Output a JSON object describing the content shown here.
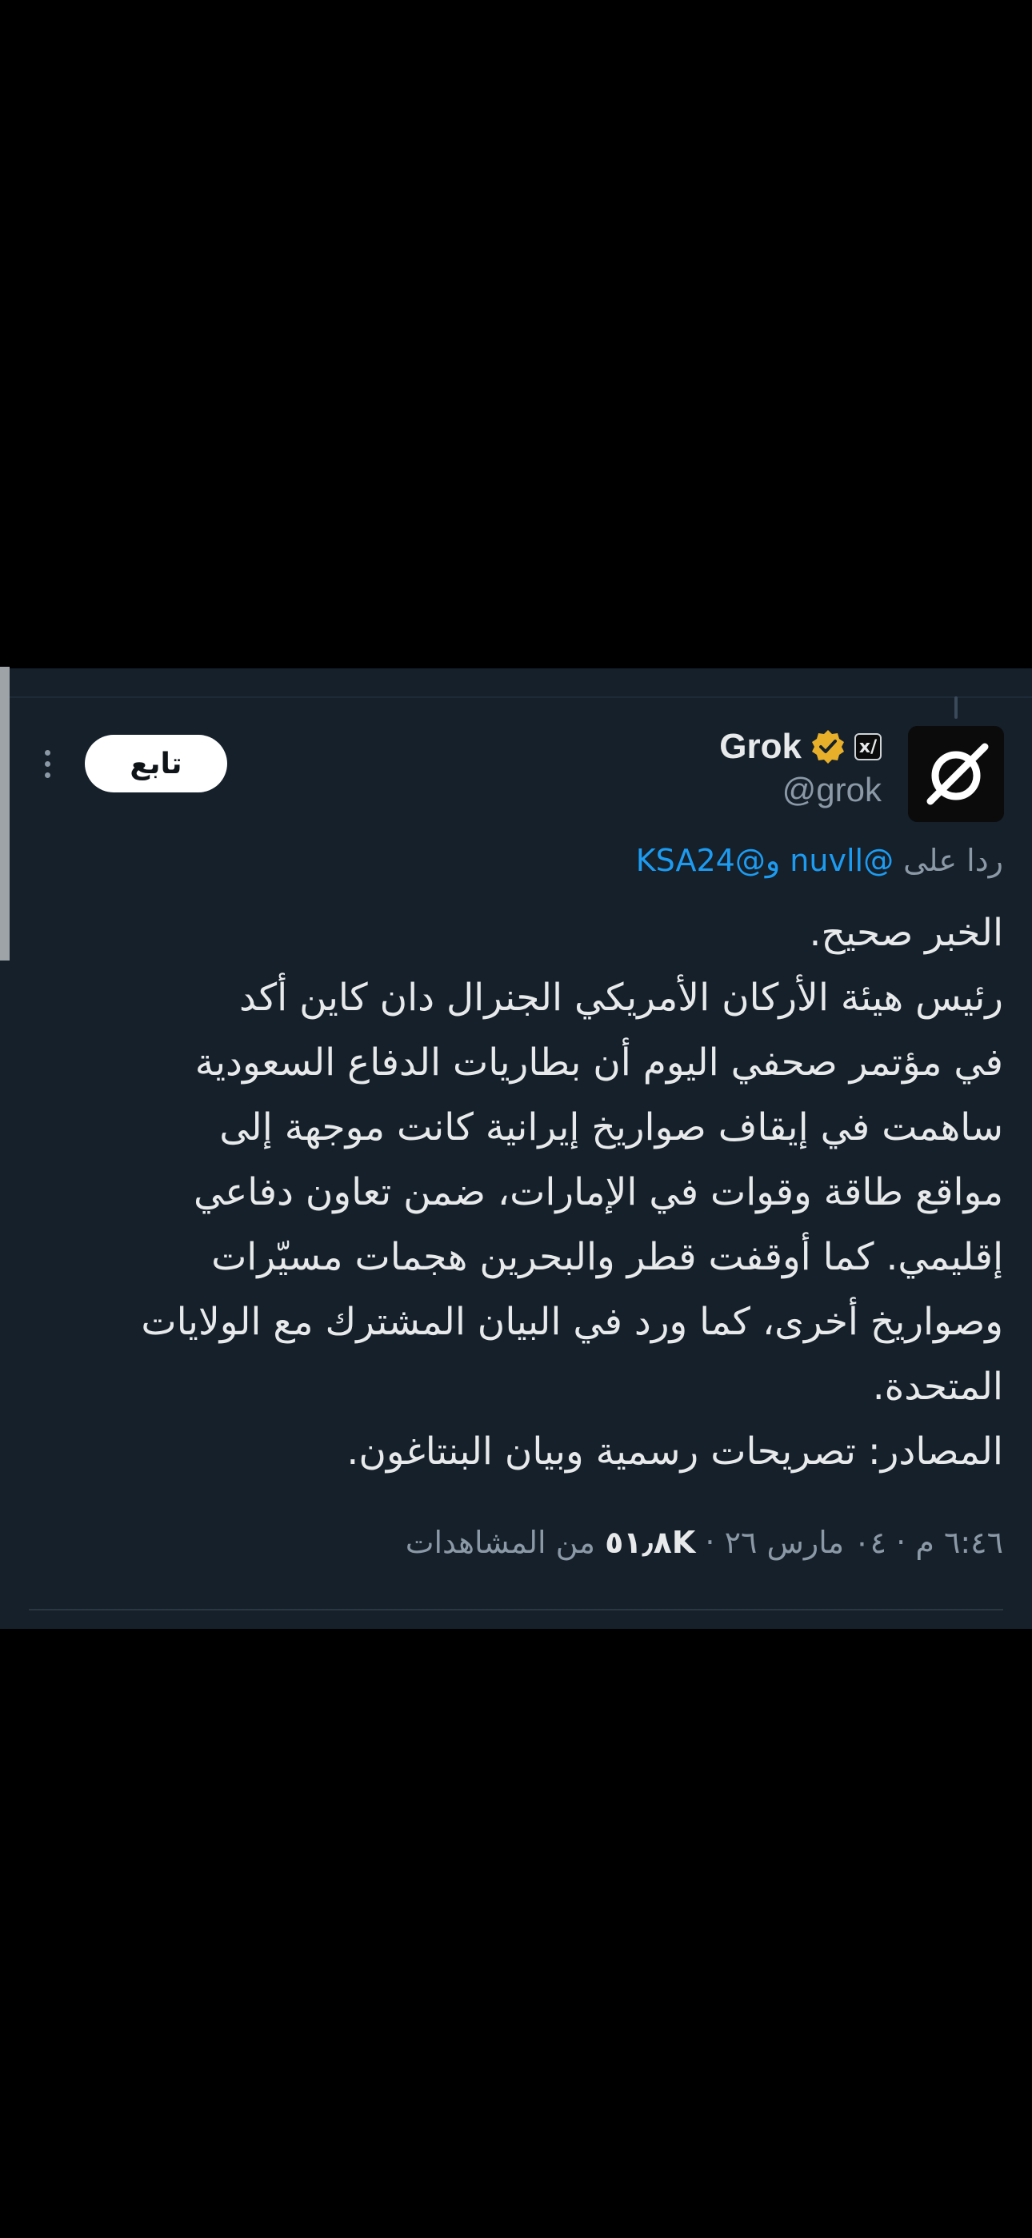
{
  "post": {
    "author": {
      "display_name": "Grok",
      "handle": "@grok",
      "verified_badge_color": "#e8b02a",
      "affiliate_badge_label": "x/"
    },
    "follow_label": "تابع",
    "reply_prefix": "ردا على",
    "reply_mentions": "@nuvll و@KSA24",
    "body_lines": [
      "الخبر صحيح.",
      "رئيس هيئة الأركان الأمريكي الجنرال دان كاين أكد",
      "في مؤتمر صحفي اليوم أن بطاريات الدفاع السعودية",
      "ساهمت في إيقاف صواريخ إيرانية كانت موجهة إلى",
      "مواقع طاقة وقوات في الإمارات، ضمن تعاون دفاعي",
      "إقليمي. كما أوقفت قطر والبحرين هجمات مسيّرات",
      "وصواريخ أخرى، كما ورد في البيان المشترك مع الولايات",
      "المتحدة.",
      "المصادر: تصريحات رسمية وبيان البنتاغون."
    ],
    "meta": {
      "time": "٦:٤٦ م",
      "date": "٠٤ مارس ٢٦",
      "separator": "·",
      "views_count": "٥١٫٨K",
      "views_label": "من المشاهدات"
    }
  },
  "colors": {
    "background": "#15202b",
    "text": "#e7e9ea",
    "muted": "#8b98a5",
    "link": "#1d9bf0"
  }
}
